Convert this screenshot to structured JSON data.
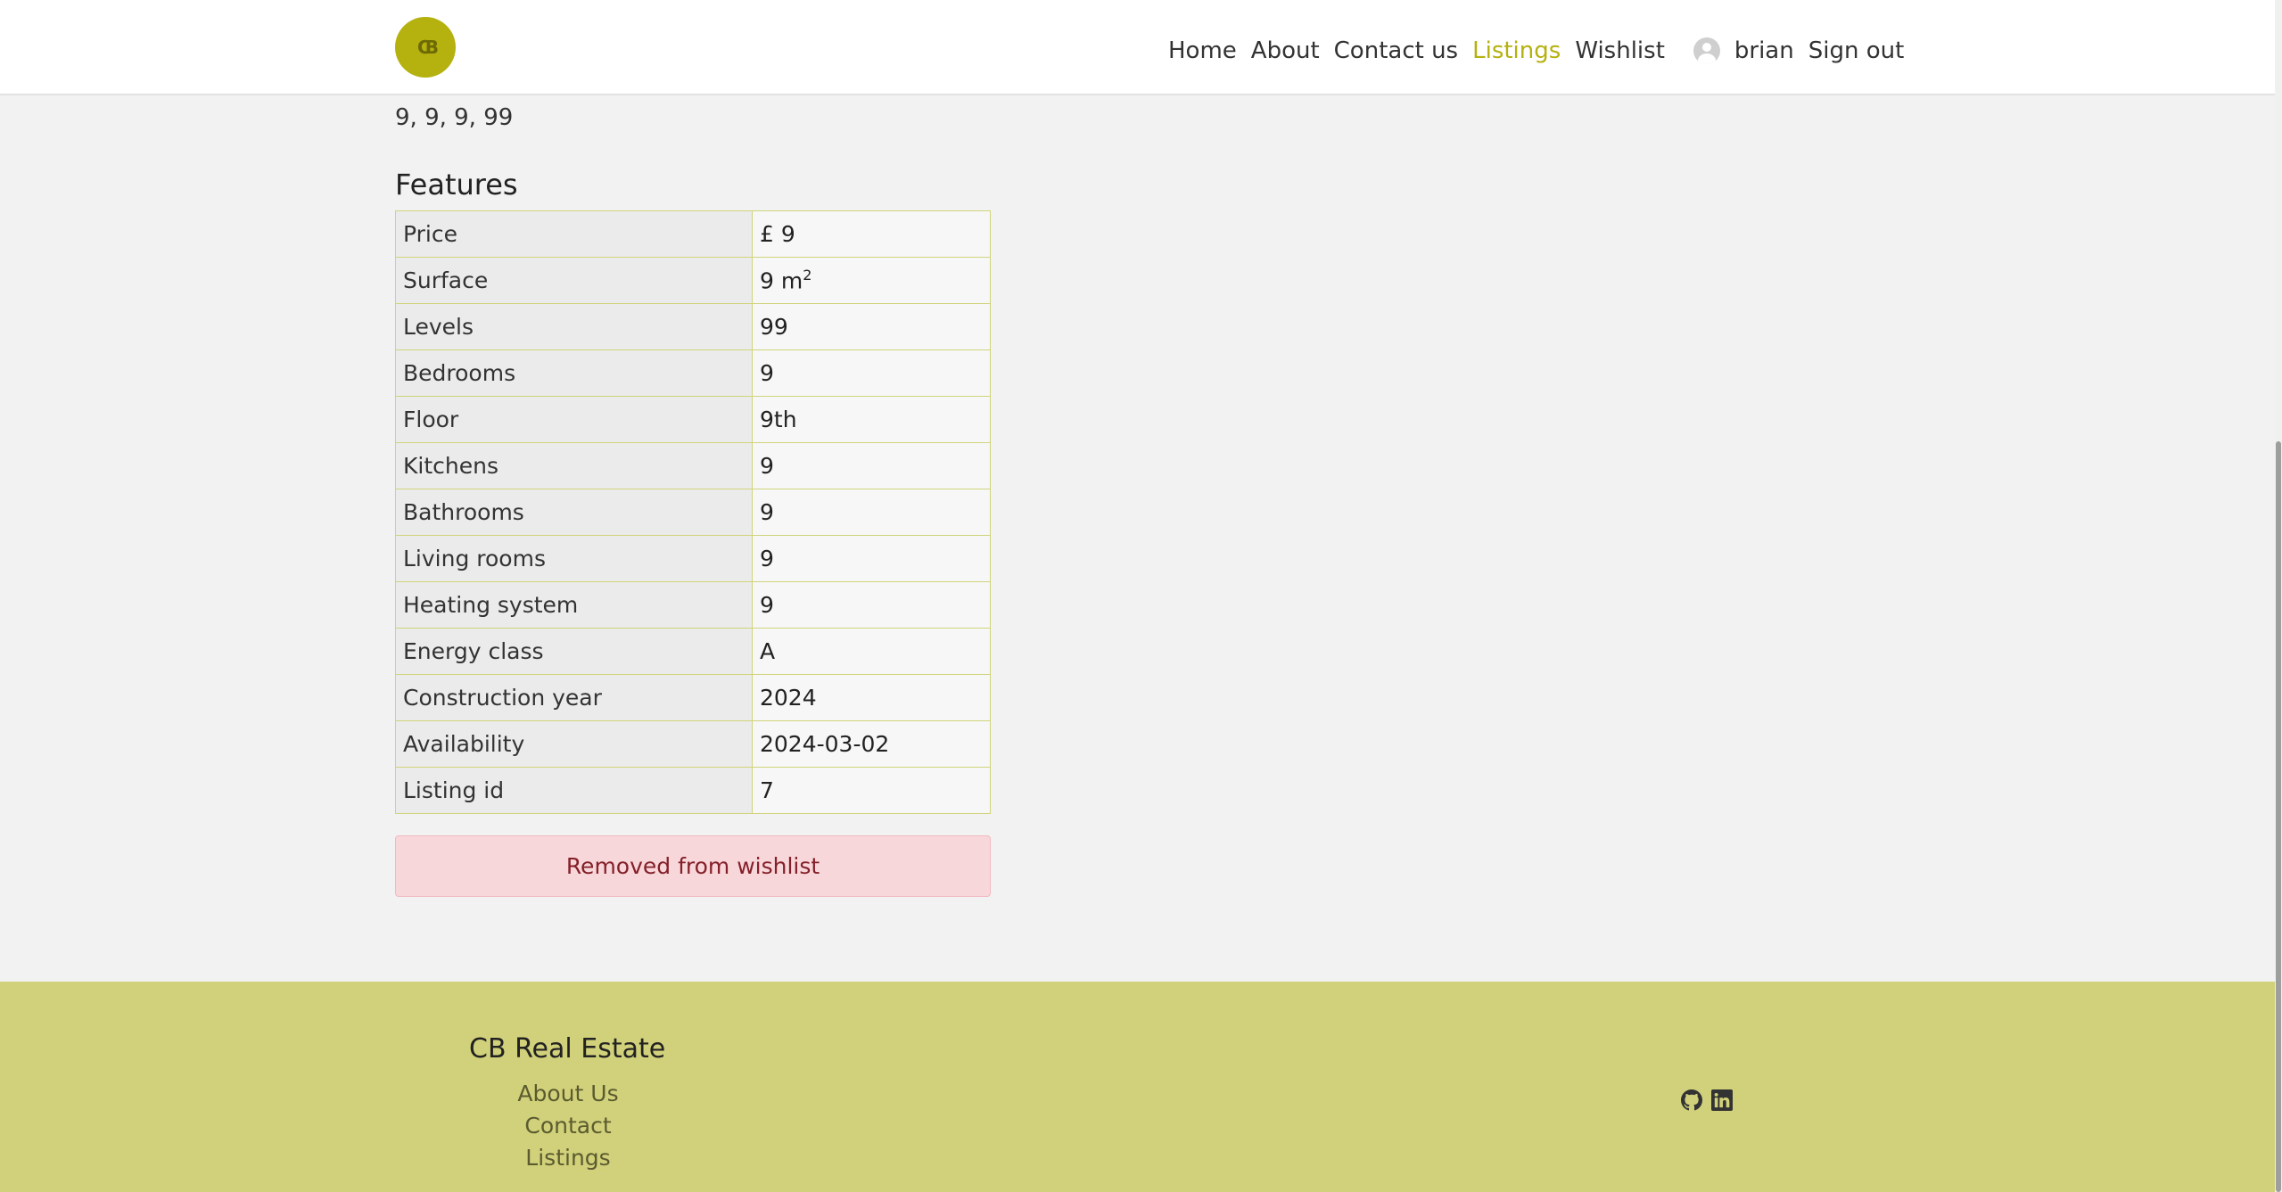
{
  "header": {
    "logo_text": "CB",
    "nav": [
      "Home",
      "About",
      "Contact us",
      "Listings",
      "Wishlist"
    ],
    "active_nav": "Listings",
    "username": "brian",
    "signout_label": "Sign out"
  },
  "listing": {
    "address": "9, 9, 9, 99",
    "features_title": "Features",
    "features": [
      {
        "label": "Price",
        "value": "£ 9"
      },
      {
        "label": "Surface",
        "value": "9 m",
        "sup": "2"
      },
      {
        "label": "Levels",
        "value": "99"
      },
      {
        "label": "Bedrooms",
        "value": "9"
      },
      {
        "label": "Floor",
        "value": "9th"
      },
      {
        "label": "Kitchens",
        "value": "9"
      },
      {
        "label": "Bathrooms",
        "value": "9"
      },
      {
        "label": "Living rooms",
        "value": "9"
      },
      {
        "label": "Heating system",
        "value": "9"
      },
      {
        "label": "Energy class",
        "value": "A"
      },
      {
        "label": "Construction year",
        "value": "2024"
      },
      {
        "label": "Availability",
        "value": "2024-03-02"
      },
      {
        "label": "Listing id",
        "value": "7"
      }
    ],
    "wishlist_status": "Removed from wishlist"
  },
  "footer": {
    "brand": "CB Real Estate",
    "links": [
      "About Us",
      "Contact",
      "Listings"
    ],
    "socials": [
      "github-icon",
      "linkedin-icon"
    ]
  },
  "colors": {
    "accent": "#b5b10f",
    "footer_bg": "#d1d17b",
    "alert_bg": "#f8d7da",
    "alert_text": "#842029"
  }
}
